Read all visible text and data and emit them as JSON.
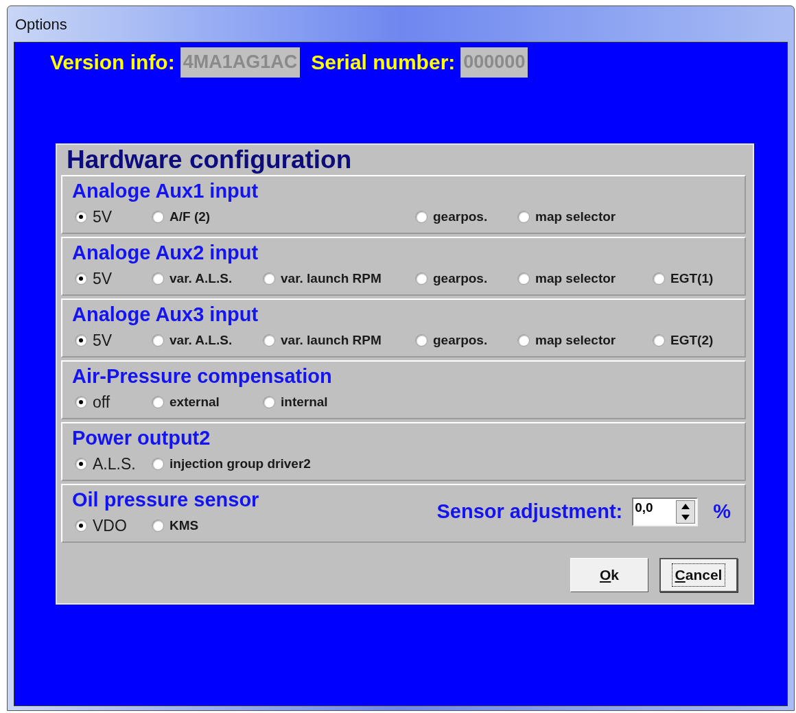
{
  "window": {
    "title": "Options"
  },
  "version_info": {
    "label": "Version info:",
    "value": "4MA1AG1AC"
  },
  "serial_number": {
    "label": "Serial number:",
    "value": "000000"
  },
  "hardware": {
    "title": "Hardware configuration",
    "groups": [
      {
        "title": "Analoge Aux1 input",
        "options": [
          {
            "label": "5V",
            "selected": true
          },
          {
            "label": "A/F (2)",
            "selected": false
          },
          {
            "label": "gearpos.",
            "selected": false
          },
          {
            "label": "map selector",
            "selected": false
          }
        ]
      },
      {
        "title": "Analoge Aux2 input",
        "options": [
          {
            "label": "5V",
            "selected": true
          },
          {
            "label": "var. A.L.S.",
            "selected": false
          },
          {
            "label": "var. launch RPM",
            "selected": false
          },
          {
            "label": "gearpos.",
            "selected": false
          },
          {
            "label": "map selector",
            "selected": false
          },
          {
            "label": "EGT(1)",
            "selected": false
          }
        ]
      },
      {
        "title": "Analoge Aux3 input",
        "options": [
          {
            "label": "5V",
            "selected": true
          },
          {
            "label": "var. A.L.S.",
            "selected": false
          },
          {
            "label": "var. launch RPM",
            "selected": false
          },
          {
            "label": "gearpos.",
            "selected": false
          },
          {
            "label": "map selector",
            "selected": false
          },
          {
            "label": "EGT(2)",
            "selected": false
          }
        ]
      },
      {
        "title": "Air-Pressure compensation",
        "options": [
          {
            "label": "off",
            "selected": true
          },
          {
            "label": "external",
            "selected": false
          },
          {
            "label": "internal",
            "selected": false
          }
        ]
      },
      {
        "title": "Power output2",
        "options": [
          {
            "label": "A.L.S.",
            "selected": true
          },
          {
            "label": "injection group driver2",
            "selected": false
          }
        ]
      },
      {
        "title": "Oil pressure sensor",
        "options": [
          {
            "label": "VDO",
            "selected": true
          },
          {
            "label": "KMS",
            "selected": false
          }
        ],
        "adjustment": {
          "label": "Sensor adjustment:",
          "value": "0,0",
          "unit": "%"
        }
      }
    ]
  },
  "buttons": [
    {
      "label": "Ok",
      "focused": false
    },
    {
      "label": "Cancel",
      "focused": true
    }
  ]
}
